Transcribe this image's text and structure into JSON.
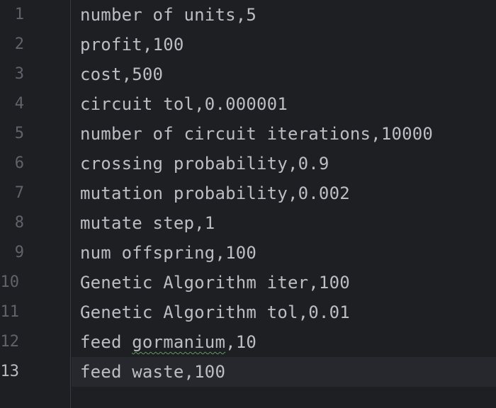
{
  "editor": {
    "current_line": 13,
    "lines": [
      {
        "number": "1",
        "text": "number of units,5"
      },
      {
        "number": "2",
        "text": "profit,100"
      },
      {
        "number": "3",
        "text": "cost,500"
      },
      {
        "number": "4",
        "text": "circuit tol,0.000001"
      },
      {
        "number": "5",
        "text": "number of circuit iterations,10000"
      },
      {
        "number": "6",
        "text": "crossing probability,0.9"
      },
      {
        "number": "7",
        "text": "mutation probability,0.002"
      },
      {
        "number": "8",
        "text": "mutate step,1"
      },
      {
        "number": "9",
        "text": "num offspring,100"
      },
      {
        "number": "10",
        "text": "Genetic Algorithm iter,100"
      },
      {
        "number": "11",
        "text": "Genetic Algorithm tol,0.01"
      },
      {
        "number": "12",
        "pre": "feed ",
        "flagged": "gormanium",
        "post": ",10"
      },
      {
        "number": "13",
        "text": "feed waste,100"
      }
    ]
  }
}
